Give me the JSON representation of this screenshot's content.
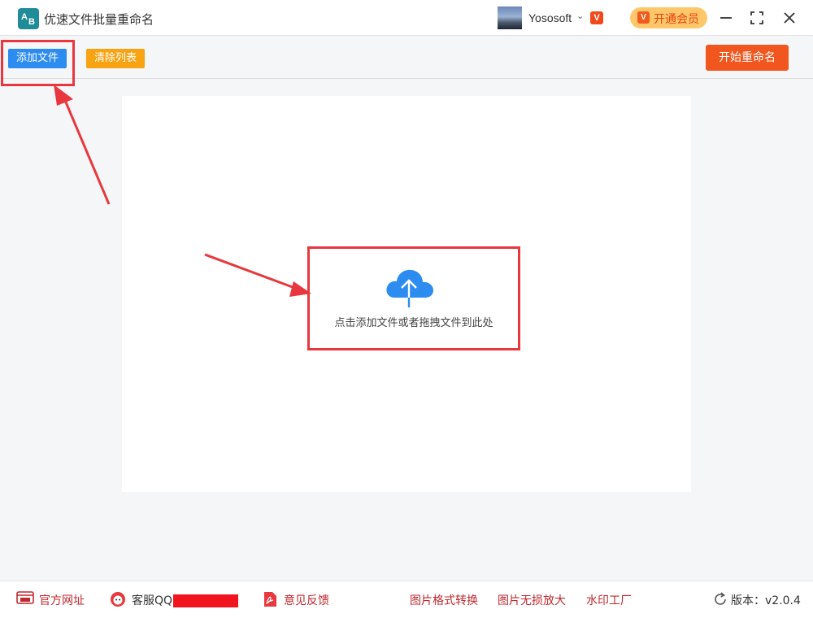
{
  "app": {
    "logo_letters": [
      "A",
      "B"
    ],
    "title": "优速文件批量重命名"
  },
  "user": {
    "name": "Yososoft",
    "chevron": "⌄",
    "vip_badge": "V"
  },
  "vip_button": {
    "icon_letter": "V",
    "label": "开通会员"
  },
  "toolbar": {
    "add_files_label": "添加文件",
    "clear_list_label": "清除列表",
    "start_rename_label": "开始重命名"
  },
  "drop_zone": {
    "hint": "点击添加文件或者拖拽文件到此处",
    "icon": "cloud-upload-icon"
  },
  "footer": {
    "website_label": "官方网址",
    "service_qq_label": "客服QQ:",
    "feedback_label": "意见反馈",
    "format_convert_label": "图片格式转换",
    "lossless_enlarge_label": "图片无损放大",
    "watermark_label": "水印工厂",
    "version_label": "版本：v2.0.4"
  },
  "colors": {
    "primary_blue": "#2d8cf0",
    "clear_orange": "#f8a312",
    "start_red": "#f0561e",
    "annotation_red": "#e8373e",
    "vip_gold": "#ffc76a",
    "footer_link_red": "#c1272d"
  }
}
